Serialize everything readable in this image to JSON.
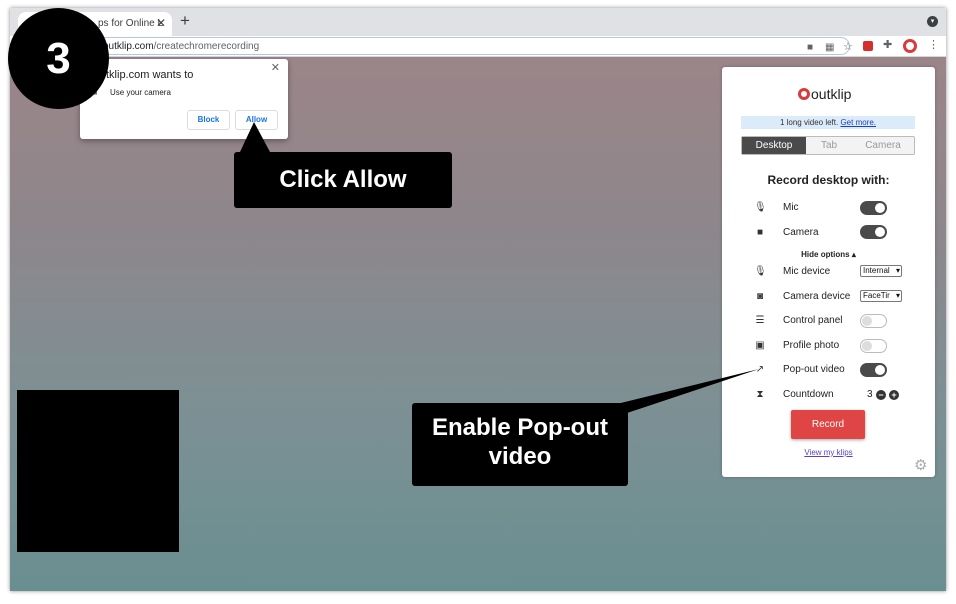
{
  "browser": {
    "tab_title": "ps for Online L",
    "tab_close": "✕",
    "new_tab": "+",
    "url_host": "outklip.com",
    "url_path": "/createchromerecording"
  },
  "permission": {
    "title": "tklip.com wants to",
    "item": "Use your camera",
    "block_label": "Block",
    "allow_label": "Allow",
    "close": "✕"
  },
  "panel": {
    "logo_text": "outklip",
    "notice_text": "1 long video left.",
    "notice_link": "Get more.",
    "modes": [
      {
        "label": "Desktop",
        "active": true
      },
      {
        "label": "Tab",
        "active": false
      },
      {
        "label": "Camera",
        "active": false
      }
    ],
    "heading": "Record desktop with:",
    "mic_label": "Mic",
    "camera_label": "Camera",
    "hide_options": "Hide options ▴",
    "mic_device_label": "Mic device",
    "mic_device_value": "Internal",
    "camera_device_label": "Camera device",
    "camera_device_value": "FaceTir",
    "control_panel_label": "Control panel",
    "profile_photo_label": "Profile photo",
    "popout_label": "Pop-out video",
    "countdown_label": "Countdown",
    "countdown_value": "3",
    "record_label": "Record",
    "view_klips": "View my klips"
  },
  "annotations": {
    "step_number": "3",
    "allow_callout": "Click Allow",
    "popout_line1": "Enable Pop-out",
    "popout_line2": "video"
  },
  "colors": {
    "record": "#e04545",
    "toggle_on": "#4a4a4a",
    "link": "#1a3fc8",
    "allow_blue": "#1a73e8"
  }
}
